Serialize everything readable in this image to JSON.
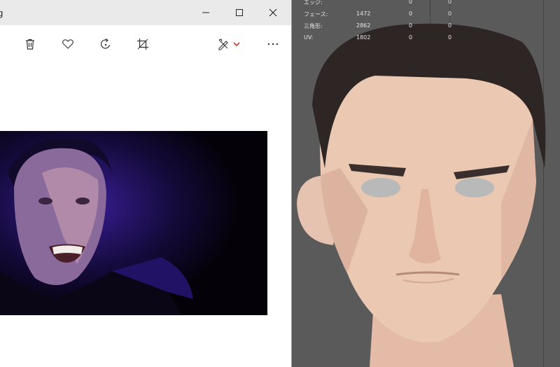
{
  "viewer": {
    "title": "g",
    "window_controls": {
      "minimize_icon": "minimize-icon",
      "maximize_icon": "maximize-icon",
      "close_icon": "close-icon"
    },
    "toolbar": {
      "items": [
        "delete-icon",
        "favorite-icon",
        "rotate-icon",
        "crop-icon",
        "edit-draw-icon",
        "more-icon"
      ],
      "dropdown_icon": "chevron-down-icon",
      "dropdown_color": "#d33a2c"
    }
  },
  "viewport": {
    "stats": [
      {
        "label": "エッジ:",
        "v1": "",
        "v2": "0",
        "v3": "0"
      },
      {
        "label": "フェース:",
        "v1": "1472",
        "v2": "0",
        "v3": "0"
      },
      {
        "label": "三角形:",
        "v1": "2862",
        "v2": "0",
        "v3": "0"
      },
      {
        "label": "UV:",
        "v1": "1802",
        "v2": "0",
        "v3": "0"
      }
    ]
  }
}
